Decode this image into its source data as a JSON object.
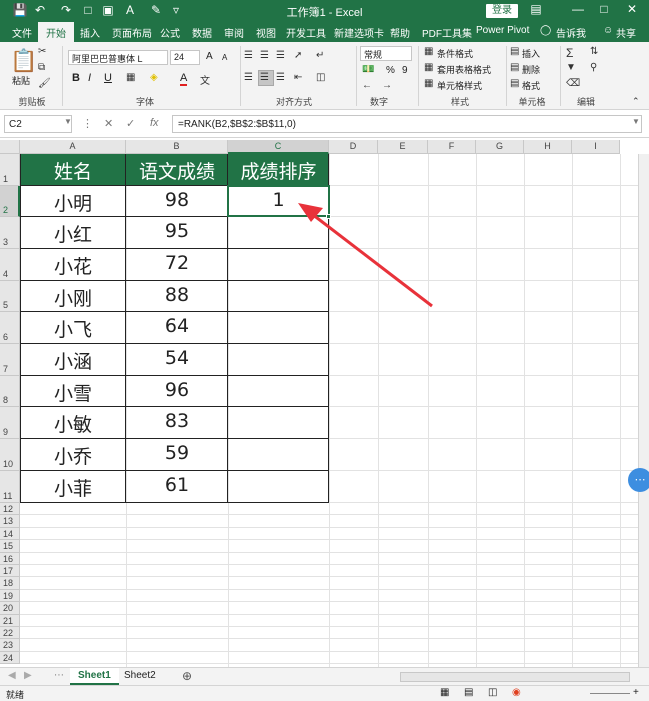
{
  "window": {
    "title": "工作簿1 - Excel",
    "login_label": "登录",
    "quick_access_icons": [
      "save-icon",
      "undo-icon",
      "redo-icon",
      "new-file-icon",
      "print-preview-icon",
      "font-color-icon",
      "format-painter-icon",
      "customize-icon"
    ]
  },
  "tabs": [
    "文件",
    "开始",
    "插入",
    "页面布局",
    "公式",
    "数据",
    "审阅",
    "视图",
    "开发工具",
    "新建选项卡",
    "帮助",
    "PDF工具集",
    "Power Pivot",
    "告诉我",
    "共享"
  ],
  "active_tab": "开始",
  "ribbon": {
    "paste_label": "粘贴",
    "clipboard_label": "剪贴板",
    "font_name": "阿里巴巴普惠体 L",
    "font_size": "24",
    "font_label": "字体",
    "alignment_label": "对齐方式",
    "number_format": "常规",
    "number_label": "数字",
    "conditional_format": "条件格式",
    "table_format": "套用表格格式",
    "cell_style": "单元格样式",
    "styles_label": "样式",
    "insert": "插入",
    "delete": "删除",
    "format": "格式",
    "cells_label": "单元格",
    "editing_label": "编辑",
    "bold": "B",
    "italic": "I",
    "underline": "U",
    "font_color": "A",
    "grow": "A",
    "shrink": "A",
    "percent": "%",
    "comma": "9"
  },
  "formula_bar": {
    "name_box": "C2",
    "formula": "=RANK(B2,$B$2:$B$11,0)"
  },
  "columns": [
    "A",
    "B",
    "C",
    "D",
    "E",
    "F",
    "G",
    "H",
    "I"
  ],
  "rows": [
    "1",
    "2",
    "3",
    "4",
    "5",
    "6",
    "7",
    "8",
    "9",
    "10",
    "11",
    "12",
    "13",
    "14",
    "15",
    "16",
    "17",
    "18",
    "19",
    "20",
    "21",
    "22",
    "23",
    "24"
  ],
  "table": {
    "headers": [
      "姓名",
      "语文成绩",
      "成绩排序"
    ],
    "rows": [
      [
        "小明",
        "98",
        "1"
      ],
      [
        "小红",
        "95",
        ""
      ],
      [
        "小花",
        "72",
        ""
      ],
      [
        "小刚",
        "88",
        ""
      ],
      [
        "小飞",
        "64",
        ""
      ],
      [
        "小涵",
        "54",
        ""
      ],
      [
        "小雪",
        "96",
        ""
      ],
      [
        "小敏",
        "83",
        ""
      ],
      [
        "小乔",
        "59",
        ""
      ],
      [
        "小菲",
        "61",
        ""
      ]
    ]
  },
  "sheets": [
    "Sheet1",
    "Sheet2"
  ],
  "status": "就绪",
  "colors": {
    "accent": "#217346",
    "arrow": "#e8323a"
  }
}
